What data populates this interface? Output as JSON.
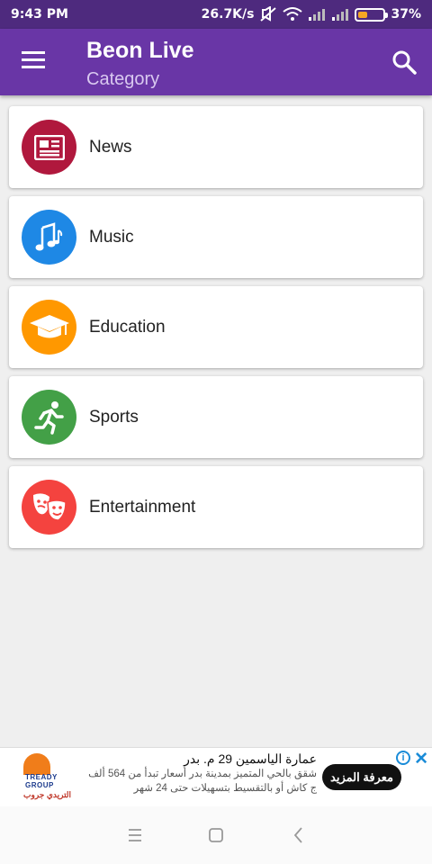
{
  "status_bar": {
    "time": "9:43 PM",
    "network_speed": "26.7K/s",
    "battery_percent": "37%",
    "battery_level": 0.37,
    "icons": [
      "mute-icon",
      "wifi-icon",
      "signal-icon",
      "signal-icon",
      "battery-icon"
    ]
  },
  "app_bar": {
    "title": "Beon Live",
    "subtitle": "Category",
    "menu_icon": "hamburger-menu-icon",
    "search_icon": "search-icon",
    "color": "#6936a6"
  },
  "categories": [
    {
      "label": "News",
      "icon": "newspaper-icon",
      "color": "#b0183d"
    },
    {
      "label": "Music",
      "icon": "music-notes-icon",
      "color": "#1e88e5"
    },
    {
      "label": "Education",
      "icon": "graduation-cap-icon",
      "color": "#ff9800"
    },
    {
      "label": "Sports",
      "icon": "runner-icon",
      "color": "#43a047"
    },
    {
      "label": "Entertainment",
      "icon": "theater-masks-icon",
      "color": "#f4433f"
    }
  ],
  "ad": {
    "logo_text": "TREADY GROUP",
    "logo_subtext": "التريدي جروب",
    "headline": "عمارة الياسمين 29 م. بدر",
    "body": "شقق بالحي المتميز بمدينة بدر أسعار تبدأ من 564 ألف ج كاش أو بالتقسيط بتسهيلات حتى 24 شهر",
    "cta": "معرفة المزيد",
    "info_icon": "info-icon",
    "close_icon": "close-icon"
  },
  "nav_bar": {
    "icons": [
      "recents-icon",
      "home-icon",
      "back-icon"
    ]
  }
}
